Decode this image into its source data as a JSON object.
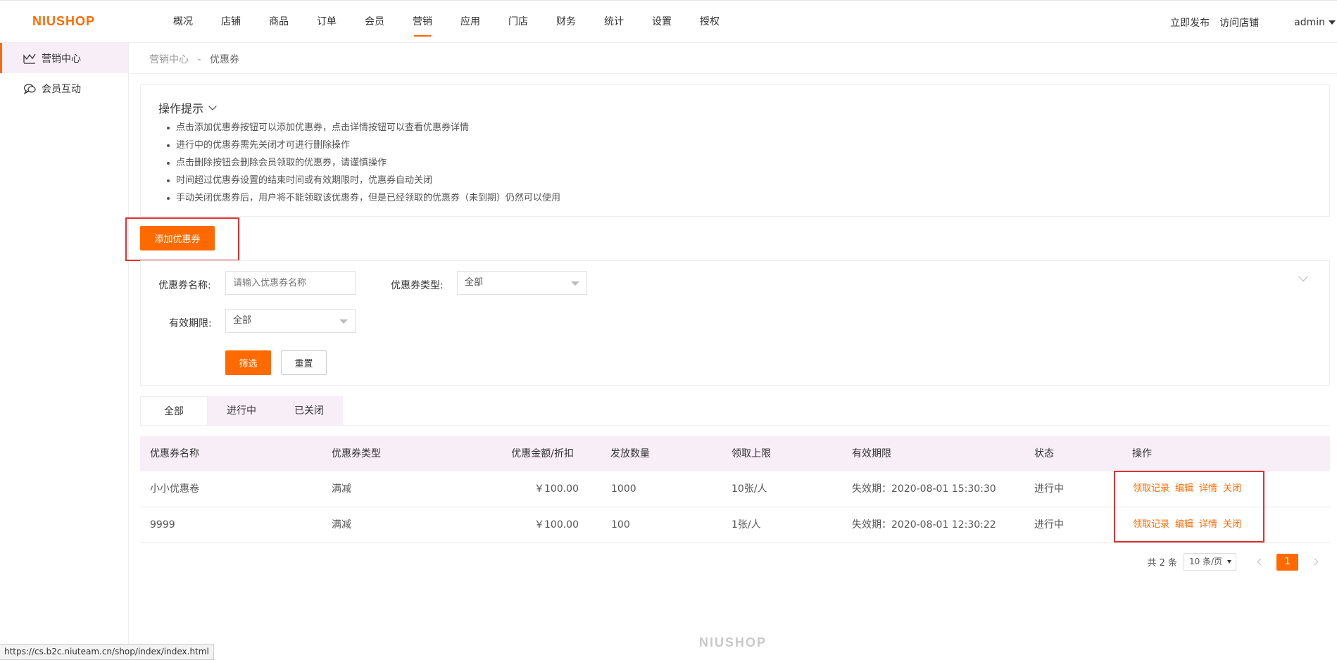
{
  "brand": {
    "logo": "NIUSHOP",
    "accent": "#ff6a00",
    "footer_logo": "NIUSHOP"
  },
  "topnav": {
    "items": [
      "概况",
      "店铺",
      "商品",
      "订单",
      "会员",
      "营销",
      "应用",
      "门店",
      "财务",
      "统计",
      "设置",
      "授权"
    ],
    "active": "营销",
    "publish": "立即发布",
    "visit": "访问店铺",
    "user": "admin"
  },
  "sidebar": {
    "items": [
      {
        "label": "营销中心",
        "icon": "chart-icon",
        "active": true
      },
      {
        "label": "会员互动",
        "icon": "chat-icon",
        "active": false
      }
    ]
  },
  "breadcrumb": {
    "parent": "营销中心",
    "sep": "-",
    "current": "优惠券"
  },
  "tips": {
    "title": "操作提示",
    "items": [
      "点击添加优惠券按钮可以添加优惠券，点击详情按钮可以查看优惠券详情",
      "进行中的优惠券需先关闭才可进行删除操作",
      "点击删除按钮会删除会员领取的优惠券，请谨慎操作",
      "时间超过优惠券设置的结束时间或有效期限时，优惠券自动关闭",
      "手动关闭优惠券后，用户将不能领取该优惠券，但是已经领取的优惠券（未到期）仍然可以使用"
    ]
  },
  "add_button": "添加优惠券",
  "filter": {
    "name_label": "优惠券名称:",
    "name_placeholder": "请输入优惠券名称",
    "type_label": "优惠券类型:",
    "type_value": "全部",
    "period_label": "有效期限:",
    "period_value": "全部",
    "submit": "筛选",
    "reset": "重置"
  },
  "tabs": [
    "全部",
    "进行中",
    "已关闭"
  ],
  "table": {
    "headers": [
      "优惠券名称",
      "优惠券类型",
      "优惠金额/折扣",
      "发放数量",
      "领取上限",
      "有效期限",
      "状态",
      "操作"
    ],
    "rows": [
      {
        "name": "小小优惠卷",
        "type": "满减",
        "amount": "￥100.00",
        "qty": "1000",
        "limit": "10张/人",
        "period": "失效期：2020-08-01 15:30:30",
        "status": "进行中"
      },
      {
        "name": "9999",
        "type": "满减",
        "amount": "￥100.00",
        "qty": "100",
        "limit": "1张/人",
        "period": "失效期：2020-08-01 12:30:22",
        "status": "进行中"
      }
    ],
    "actions": [
      "领取记录",
      "编辑",
      "详情",
      "关闭"
    ]
  },
  "pagination": {
    "total": "共 2 条",
    "page_size": "10 条/页",
    "current": "1"
  },
  "status_bar_url": "https://cs.b2c.niuteam.cn/shop/index/index.html"
}
